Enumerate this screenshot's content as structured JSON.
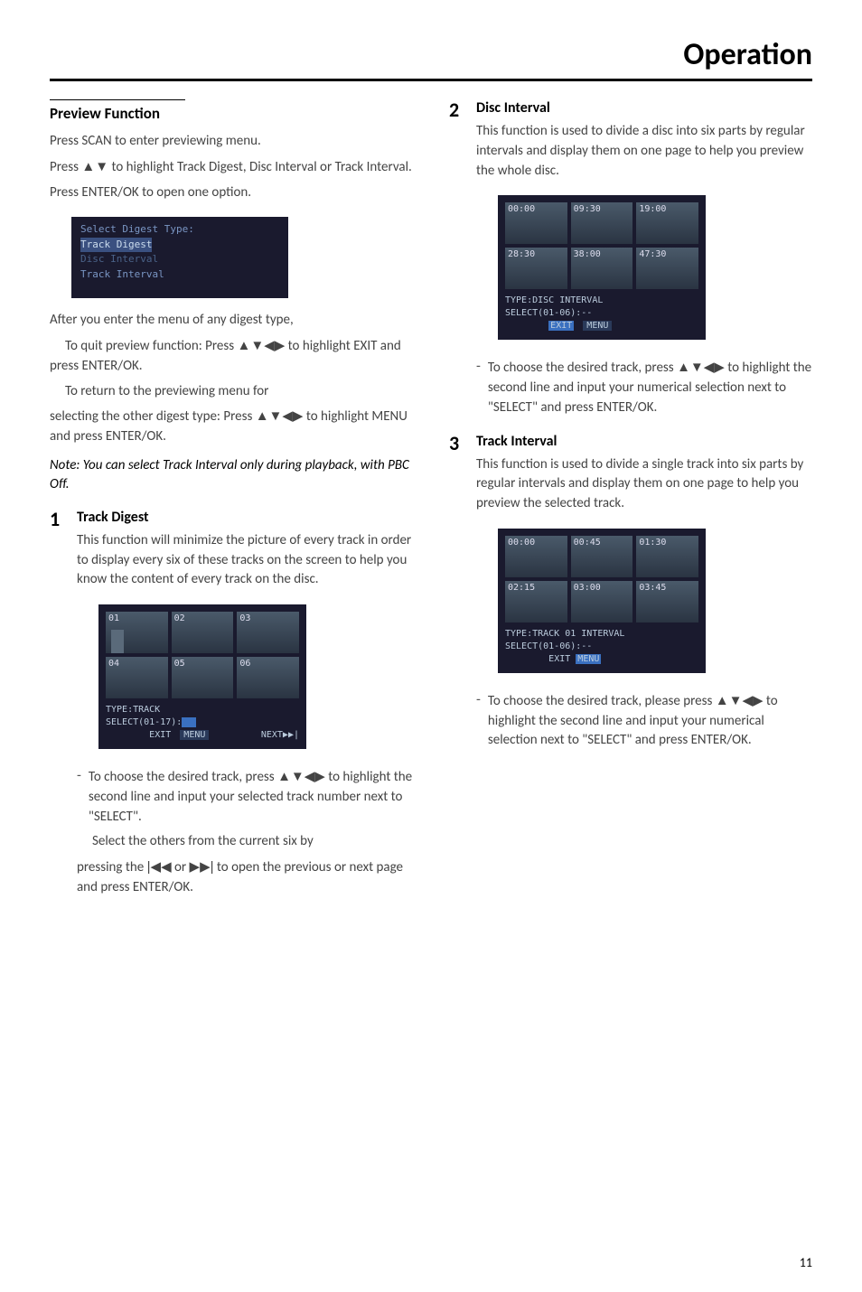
{
  "page_title": "Operation",
  "page_number": "11",
  "left": {
    "section_title": "Preview Function",
    "intro_1": "Press SCAN to enter previewing menu.",
    "intro_2_a": "Press ",
    "intro_2_b": " to highlight Track Digest, Disc Interval or Track Interval.",
    "intro_3": "Press ENTER/OK to open one option.",
    "menu_shot": {
      "line1": "Select Digest Type:",
      "line2": "Track Digest",
      "line3": "Disc Interval",
      "line4": "Track Interval"
    },
    "after_menu_1": "After you enter the menu of any digest type,",
    "quit_a": "To quit preview function: Press ",
    "quit_b": " to highlight EXIT and press ENTER/OK.",
    "return_1": "To return to the previewing menu for",
    "return_2_a": "selecting the other digest type: Press ",
    "return_2_b": " to highlight MENU and press ENTER/OK.",
    "note": "Note: You can select Track Interval only during playback, with PBC Off.",
    "item1": {
      "num": "1",
      "title": "Track Digest",
      "body": "This function will minimize the picture of every track in order to display every six of these tracks on the screen to help you know the content of every track on the disc.",
      "shot_labels": [
        "01",
        "02",
        "03",
        "04",
        "05",
        "06"
      ],
      "shot_footer_type": "TYPE:TRACK",
      "shot_footer_select": "SELECT(01-17):",
      "shot_footer_exit": "EXIT",
      "shot_footer_menu": "MENU",
      "shot_footer_next": "NEXT▶▶|",
      "dash_a": "To choose the desired track, press ",
      "dash_b": " to highlight the second line and input your selected track number next to \"SELECT\".",
      "tail_1": "Select the others from the current six by",
      "tail_2_a": "pressing the ",
      "tail_2_b": " or ",
      "tail_2_c": " to open the previous or next page and press ENTER/OK."
    }
  },
  "right": {
    "item2": {
      "num": "2",
      "title": "Disc Interval",
      "body": "This function is used to divide a disc into six parts by regular intervals and display them on one page to help you preview the whole disc.",
      "shot_labels": [
        "00:00",
        "09:30",
        "19:00",
        "28:30",
        "38:00",
        "47:30"
      ],
      "shot_footer_type": "TYPE:DISC INTERVAL",
      "shot_footer_select": "SELECT(01-06):--",
      "shot_footer_exit": "EXIT",
      "shot_footer_menu": "MENU",
      "dash_a": "To choose the desired track, press ",
      "dash_b": " to highlight the second line and input your numerical selection next to \"SELECT\" and press ENTER/OK."
    },
    "item3": {
      "num": "3",
      "title": "Track Interval",
      "body": "This function is used to divide a single track into six parts by regular intervals and display them on one page to help you preview the selected track.",
      "shot_labels": [
        "00:00",
        "00:45",
        "01:30",
        "02:15",
        "03:00",
        "03:45"
      ],
      "shot_footer_type": "TYPE:TRACK 01 INTERVAL",
      "shot_footer_select": "SELECT(01-06):--",
      "shot_footer_exit": "EXIT",
      "shot_footer_menu": "MENU",
      "dash_a": "To choose the desired track, please press ",
      "dash_b": " to highlight the second line and input your numerical selection next to \"SELECT\" and press ENTER/OK."
    }
  },
  "glyphs": {
    "updown": "▲▼",
    "all4": "▲▼◀▶",
    "prev": "|◀◀",
    "next": "▶▶|"
  }
}
